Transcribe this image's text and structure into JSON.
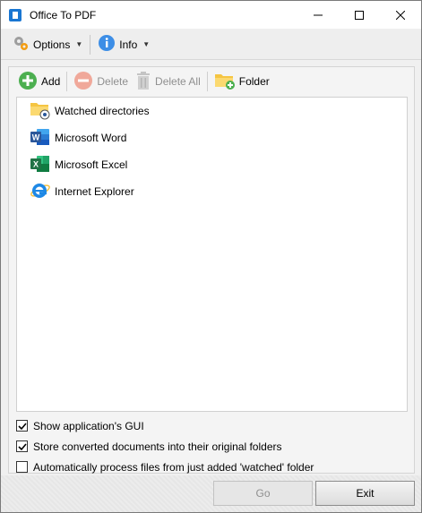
{
  "window": {
    "title": "Office To PDF"
  },
  "toolbar": {
    "options_label": "Options",
    "info_label": "Info"
  },
  "panel_toolbar": {
    "add_label": "Add",
    "delete_label": "Delete",
    "delete_all_label": "Delete All",
    "folder_label": "Folder"
  },
  "list": {
    "items": [
      {
        "label": "Watched directories",
        "icon": "watched-folder-icon"
      },
      {
        "label": "Microsoft Word",
        "icon": "word-icon"
      },
      {
        "label": "Microsoft Excel",
        "icon": "excel-icon"
      },
      {
        "label": "Internet Explorer",
        "icon": "ie-icon"
      }
    ]
  },
  "options": {
    "show_gui": {
      "label": "Show application's GUI",
      "checked": true
    },
    "store_converted": {
      "label": "Store converted documents into their original folders",
      "checked": true
    },
    "auto_process": {
      "label": "Automatically process files from just added 'watched' folder",
      "checked": false
    }
  },
  "footer": {
    "go_label": "Go",
    "exit_label": "Exit"
  },
  "colors": {
    "word_blue": "#2b579a",
    "excel_green": "#217346",
    "ie_blue": "#1e88e5",
    "add_green": "#4caf50",
    "folder_yellow": "#f5c542"
  }
}
